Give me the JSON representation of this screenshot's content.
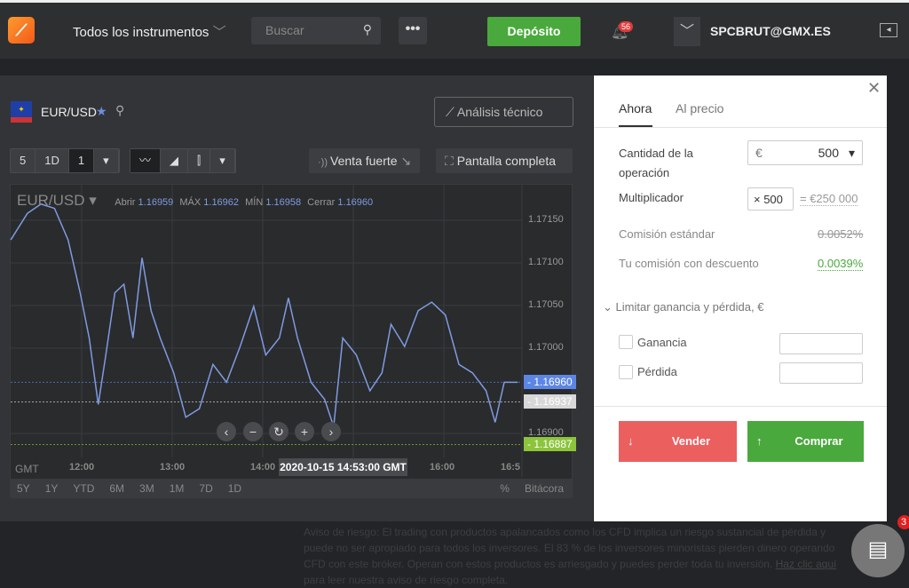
{
  "topbar": {
    "instruments": "Todos los instrumentos",
    "search_placeholder": "Buscar",
    "more": "•••",
    "deposit": "Depósito",
    "notifications": "56",
    "user": "SPCBRUT@GMX.ES"
  },
  "instrument": {
    "symbol": "EUR/USD",
    "analysis": "Análisis técnico"
  },
  "toolbar": {
    "intervals": [
      "5",
      "1D",
      "1"
    ],
    "sentiment": "Venta fuerte",
    "fullscreen": "Pantalla completa"
  },
  "ohlc": {
    "symbol": "EUR/USD",
    "open_label": "Abrir",
    "open": "1.16959",
    "high_label": "MÁX",
    "high": "1.16962",
    "low_label": "MÍN",
    "low": "1.16958",
    "close_label": "Cerrar",
    "close": "1.16960"
  },
  "chart_data": {
    "type": "line",
    "color": "#7e9be0",
    "y_ticks": [
      "1.17150",
      "1.17100",
      "1.17050",
      "1.17000",
      "1.16900"
    ],
    "x_ticks": [
      "12:00",
      "13:00",
      "14:00",
      "16:00",
      "16:5"
    ],
    "tz": "GMT",
    "crosshair_time": "2020-10-15 14:53:00 GMT",
    "price_tags": [
      {
        "value": "1.16960",
        "color": "#5b86e5"
      },
      {
        "value": "1.16937",
        "color": "#d8d8d8"
      },
      {
        "value": "1.16887",
        "color": "#8cc43c"
      }
    ],
    "points": [
      [
        "11:13",
        1.17127
      ],
      [
        "11:24",
        1.17158
      ],
      [
        "11:33",
        1.17169
      ],
      [
        "11:42",
        1.17164
      ],
      [
        "11:51",
        1.17127
      ],
      [
        "11:59",
        1.17065
      ],
      [
        "12:05",
        1.17012
      ],
      [
        "12:11",
        1.16934
      ],
      [
        "12:16",
        1.16992
      ],
      [
        "12:22",
        1.17065
      ],
      [
        "12:28",
        1.17075
      ],
      [
        "12:34",
        1.17012
      ],
      [
        "12:40",
        1.17106
      ],
      [
        "12:46",
        1.17044
      ],
      [
        "12:52",
        1.17012
      ],
      [
        "13:01",
        1.16971
      ],
      [
        "13:09",
        1.16919
      ],
      [
        "13:18",
        1.16929
      ],
      [
        "13:27",
        1.16981
      ],
      [
        "13:36",
        1.1696
      ],
      [
        "13:45",
        1.17002
      ],
      [
        "13:54",
        1.17049
      ],
      [
        "14:02",
        1.16992
      ],
      [
        "14:11",
        1.17012
      ],
      [
        "14:17",
        1.17059
      ],
      [
        "14:23",
        1.17012
      ],
      [
        "14:32",
        1.1696
      ],
      [
        "14:41",
        1.1694
      ],
      [
        "14:47",
        1.16908
      ],
      [
        "14:53",
        1.17012
      ],
      [
        "15:02",
        1.16992
      ],
      [
        "15:11",
        1.1695
      ],
      [
        "15:19",
        1.16971
      ],
      [
        "15:25",
        1.17028
      ],
      [
        "15:34",
        1.17002
      ],
      [
        "15:43",
        1.17044
      ],
      [
        "15:52",
        1.17054
      ],
      [
        "16:01",
        1.17039
      ],
      [
        "16:10",
        1.16981
      ],
      [
        "16:19",
        1.16971
      ],
      [
        "16:28",
        1.1695
      ],
      [
        "16:34",
        1.16913
      ],
      [
        "16:40",
        1.1696
      ],
      [
        "16:49",
        1.1696
      ]
    ]
  },
  "ranges": [
    "5Y",
    "1Y",
    "YTD",
    "6M",
    "3M",
    "1M",
    "7D",
    "1D"
  ],
  "range_right": [
    "%",
    "Bitácora"
  ],
  "order": {
    "tabs": [
      "Ahora",
      "Al precio"
    ],
    "amount_label": "Cantidad de la operación",
    "currency": "€",
    "amount": "500",
    "mult_label": "Multiplicador",
    "mult": "× 500",
    "mult_total": "= €250 000",
    "std_fee_label": "Comisión estándar",
    "std_fee": "0.0052%",
    "disc_fee_label": "Tu comisión con descuento",
    "disc_fee": "0.0039%",
    "limit_label": "Limitar ganancia y pérdida, €",
    "profit": "Ganancia",
    "loss": "Pérdida",
    "sell": "Vender",
    "buy": "Comprar"
  },
  "risk": {
    "text": "Aviso de riesgo: El trading con productos apalancados como los CFD implica un riesgo sustancial de pérdida y puede no ser apropiado para todos los inversores. El 83 % de los inversores minoristas pierden dinero operando CFD con este bróker. Operan con estos productos es arriesgado y puedes perder toda tu inversión. ",
    "link": "Haz clic aquí",
    "tail": " para leer nuestra aviso de riesgo completa."
  },
  "chat_badge": "3"
}
